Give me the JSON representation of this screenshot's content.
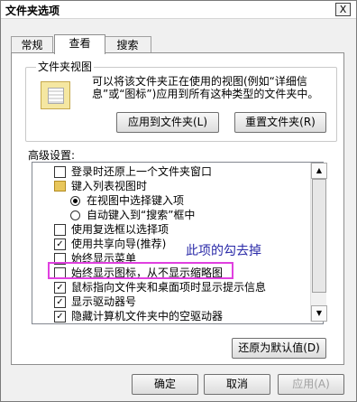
{
  "window": {
    "title": "文件夹选项",
    "close_label": "X"
  },
  "tabs": [
    {
      "label": "常规",
      "active": false
    },
    {
      "label": "查看",
      "active": true
    },
    {
      "label": "搜索",
      "active": false
    }
  ],
  "folder_view": {
    "group_label": "文件夹视图",
    "description": "可以将该文件夹正在使用的视图(例如“详细信息”或“图标”)应用到所有这种类型的文件夹中。",
    "apply_button": "应用到文件夹(L)",
    "reset_button": "重置文件夹(R)"
  },
  "advanced": {
    "label": "高级设置:",
    "items": [
      {
        "type": "checkbox",
        "checked": false,
        "indent": 0,
        "label": "登录时还原上一个文件夹窗口"
      },
      {
        "type": "folder",
        "indent": 0,
        "label": "键入列表视图时"
      },
      {
        "type": "radio",
        "checked": true,
        "indent": 1,
        "label": "在视图中选择键入项"
      },
      {
        "type": "radio",
        "checked": false,
        "indent": 1,
        "label": "自动键入到“搜索”框中"
      },
      {
        "type": "checkbox",
        "checked": false,
        "indent": 0,
        "label": "使用复选框以选择项"
      },
      {
        "type": "checkbox",
        "checked": true,
        "indent": 0,
        "label": "使用共享向导(推荐)"
      },
      {
        "type": "checkbox",
        "checked": false,
        "indent": 0,
        "label": "始终显示菜单"
      },
      {
        "type": "checkbox",
        "checked": false,
        "indent": 0,
        "label": "始终显示图标，从不显示缩略图"
      },
      {
        "type": "checkbox",
        "checked": true,
        "indent": 0,
        "label": "鼠标指向文件夹和桌面项时显示提示信息"
      },
      {
        "type": "checkbox",
        "checked": true,
        "indent": 0,
        "label": "显示驱动器号"
      },
      {
        "type": "checkbox",
        "checked": true,
        "indent": 0,
        "label": "隐藏计算机文件夹中的空驱动器"
      }
    ],
    "restore_button": "还原为默认值(D)"
  },
  "annotation": {
    "text": "此项的勾去掉"
  },
  "footer": {
    "ok": "确定",
    "cancel": "取消",
    "apply": "应用(A)"
  }
}
